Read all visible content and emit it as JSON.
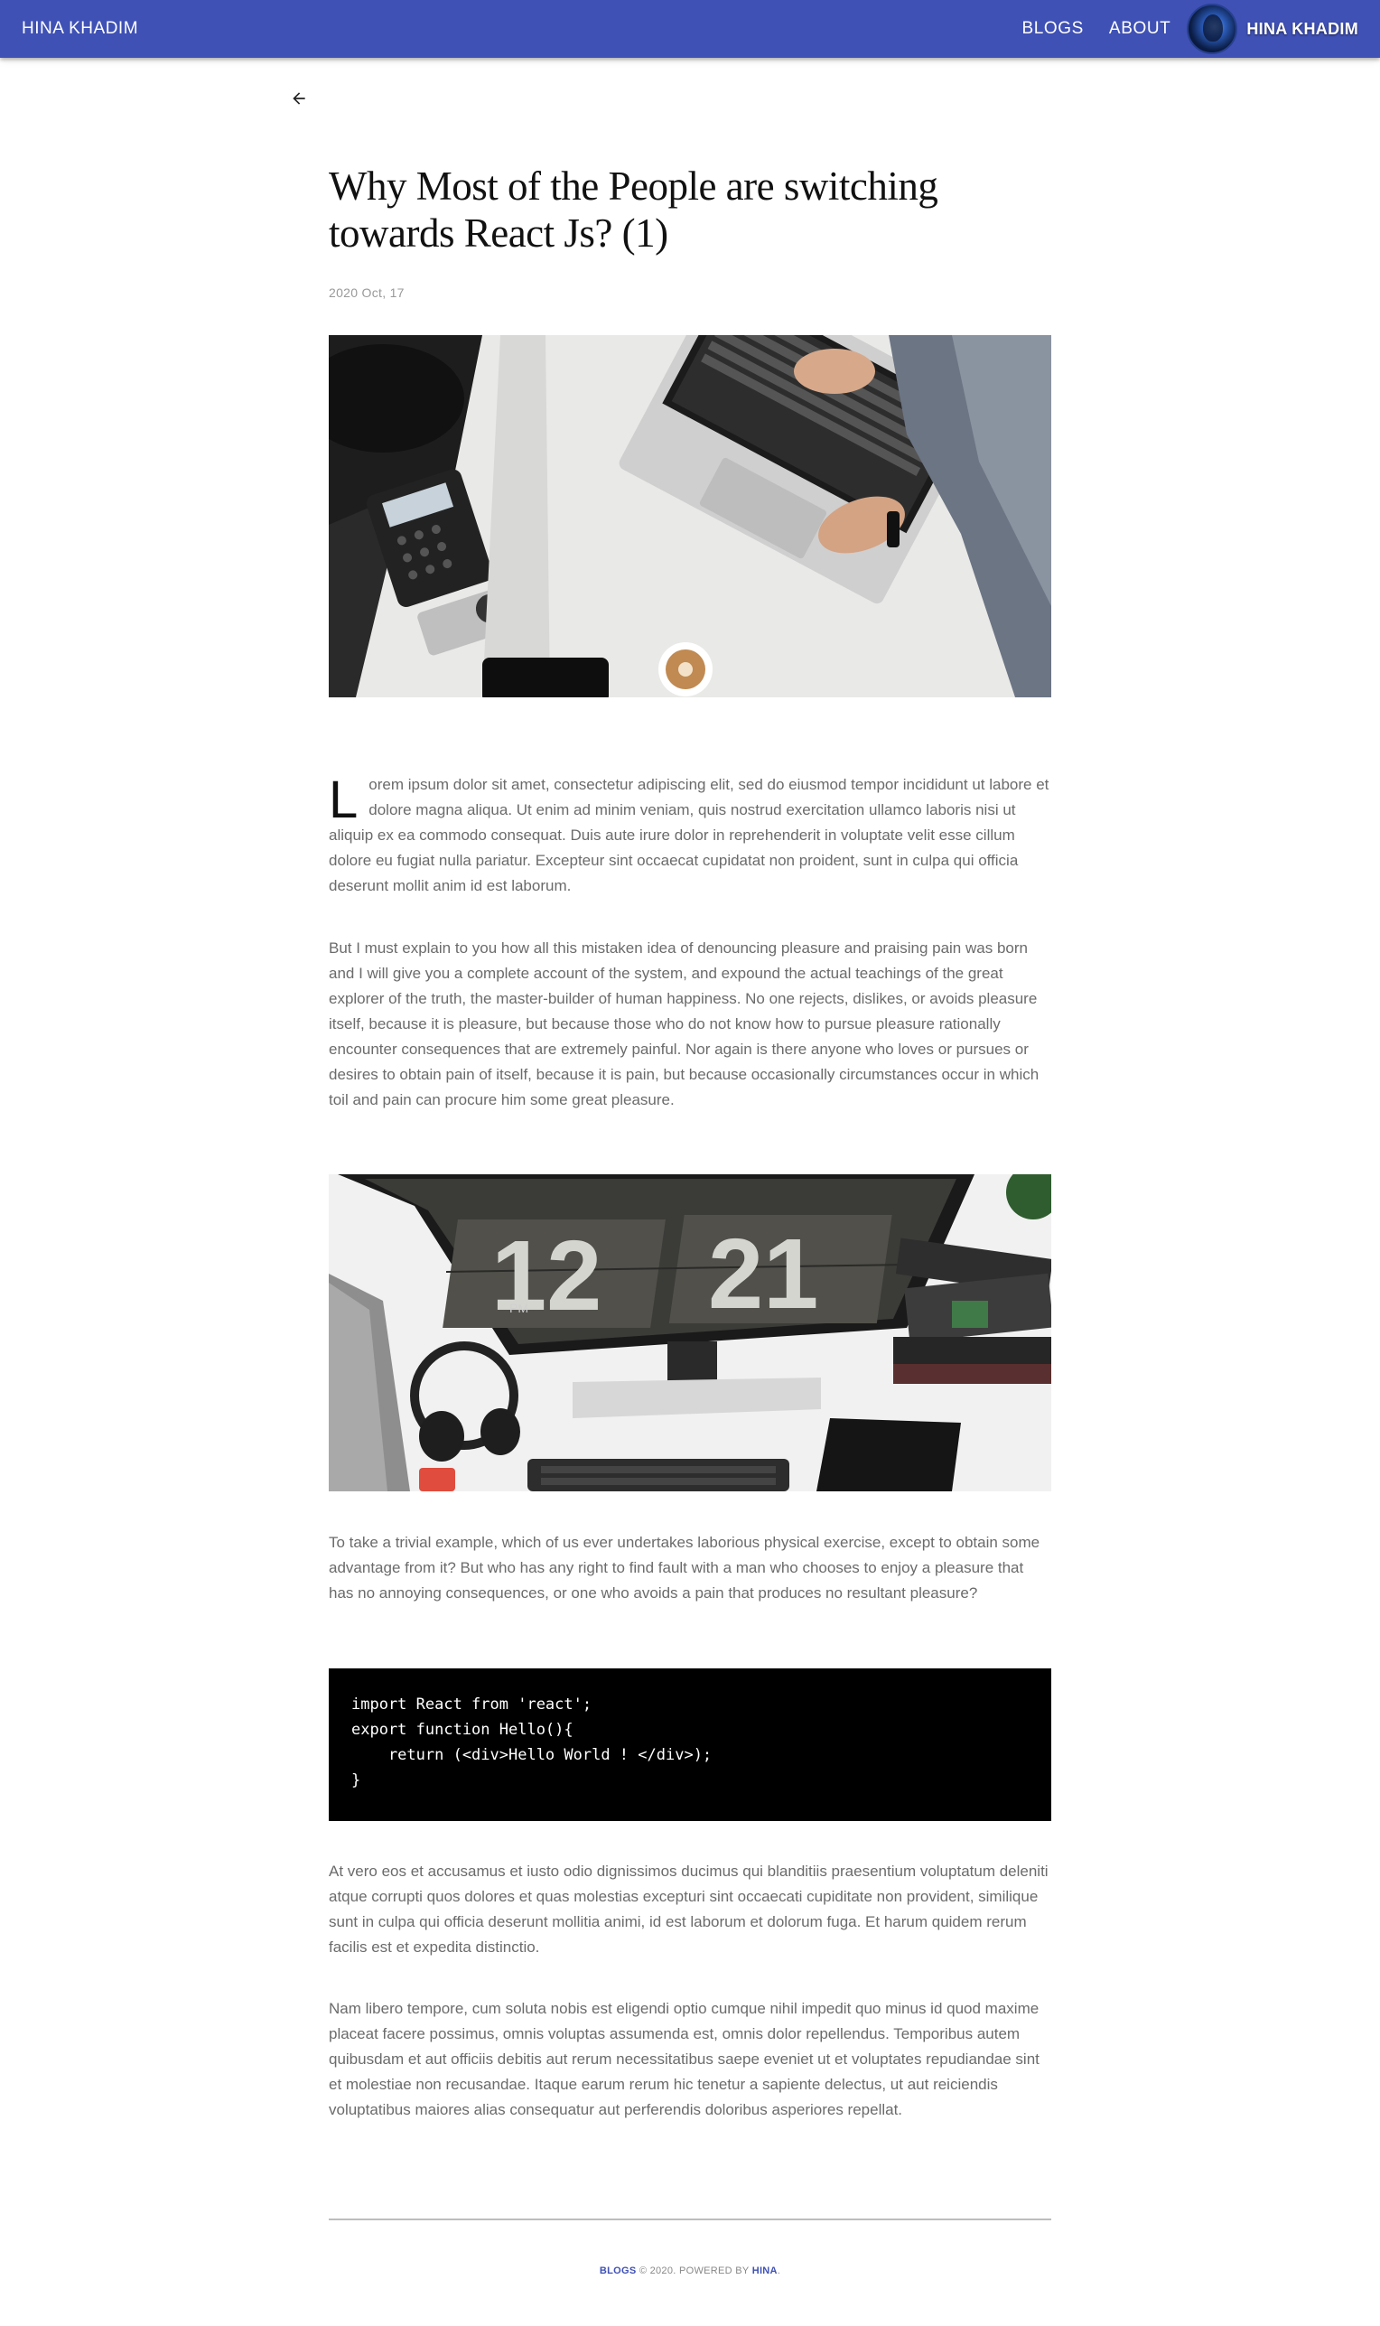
{
  "appbar": {
    "brand": "HINA KHADIM",
    "nav": [
      "BLOGS",
      "ABOUT"
    ],
    "profile_name": "HINA KHADIM"
  },
  "icons": {
    "back": "arrow-left-icon",
    "avatar": "avatar"
  },
  "article": {
    "title": "Why Most of the People are switching towards React Js? (1)",
    "date": "2020 Oct, 17",
    "images": [
      "workspace-photo",
      "desk-clock-photo"
    ],
    "dropcap": "L",
    "paragraphs": [
      "orem ipsum dolor sit amet, consectetur adipiscing elit, sed do eiusmod tempor incididunt ut labore et dolore magna aliqua. Ut enim ad minim veniam, quis nostrud exercitation ullamco laboris nisi ut aliquip ex ea commodo consequat. Duis aute irure dolor in reprehenderit in voluptate velit esse cillum dolore eu fugiat nulla pariatur. Excepteur sint occaecat cupidatat non proident, sunt in culpa qui officia deserunt mollit anim id est laborum.",
      "But I must explain to you how all this mistaken idea of denouncing pleasure and praising pain was born and I will give you a complete account of the system, and expound the actual teachings of the great explorer of the truth, the master-builder of human happiness. No one rejects, dislikes, or avoids pleasure itself, because it is pleasure, but because those who do not know how to pursue pleasure rationally encounter consequences that are extremely painful. Nor again is there anyone who loves or pursues or desires to obtain pain of itself, because it is pain, but because occasionally circumstances occur in which toil and pain can procure him some great pleasure.",
      "To take a trivial example, which of us ever undertakes laborious physical exercise, except to obtain some advantage from it? But who has any right to find fault with a man who chooses to enjoy a pleasure that has no annoying consequences, or one who avoids a pain that produces no resultant pleasure?",
      "At vero eos et accusamus et iusto odio dignissimos ducimus qui blanditiis praesentium voluptatum deleniti atque corrupti quos dolores et quas molestias excepturi sint occaecati cupiditate non provident, similique sunt in culpa qui officia deserunt mollitia animi, id est laborum et dolorum fuga. Et harum quidem rerum facilis est et expedita distinctio.",
      "Nam libero tempore, cum soluta nobis est eligendi optio cumque nihil impedit quo minus id quod maxime placeat facere possimus, omnis voluptas assumenda est, omnis dolor repellendus. Temporibus autem quibusdam et aut officiis debitis aut rerum necessitatibus saepe eveniet ut et voluptates repudiandae sint et molestiae non recusandae. Itaque earum rerum hic tenetur a sapiente delectus, ut aut reiciendis voluptatibus maiores alias consequatur aut perferendis doloribus asperiores repellat."
    ],
    "code": "import React from 'react';\nexport function Hello(){\n    return (<div>Hello World ! </div>);\n}",
    "clock_digits": [
      "12",
      "21"
    ],
    "clock_ampm": "PM"
  },
  "footer": {
    "link1": "BLOGS",
    "middle": " © 2020. POWERED BY ",
    "link2": "HINA",
    "end": "."
  },
  "colors": {
    "appbar": "#3f51b5",
    "code_bg": "#000000",
    "text": "#6b6b6b"
  }
}
